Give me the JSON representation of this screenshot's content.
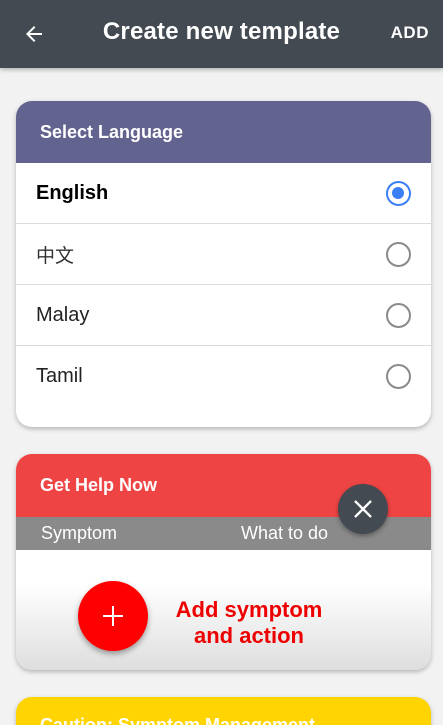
{
  "appbar": {
    "back_icon": "arrow-left-icon",
    "title": "Create new template",
    "add_label": "ADD"
  },
  "language_card": {
    "title": "Select Language",
    "header_color": "#636390",
    "options": [
      {
        "label": "English",
        "selected": true
      },
      {
        "label": "中文",
        "selected": false
      },
      {
        "label": "Malay",
        "selected": false
      },
      {
        "label": "Tamil",
        "selected": false
      }
    ]
  },
  "help_card": {
    "title": "Get Help Now",
    "header_color": "#ef4444",
    "columns": [
      "Symptom",
      "What to do"
    ],
    "add_icon": "plus-icon",
    "add_label": "Add symptom and action"
  },
  "close_icon": "close-icon",
  "caution_card": {
    "title": "Caution: Symptom Management",
    "header_color": "#ffd400"
  }
}
